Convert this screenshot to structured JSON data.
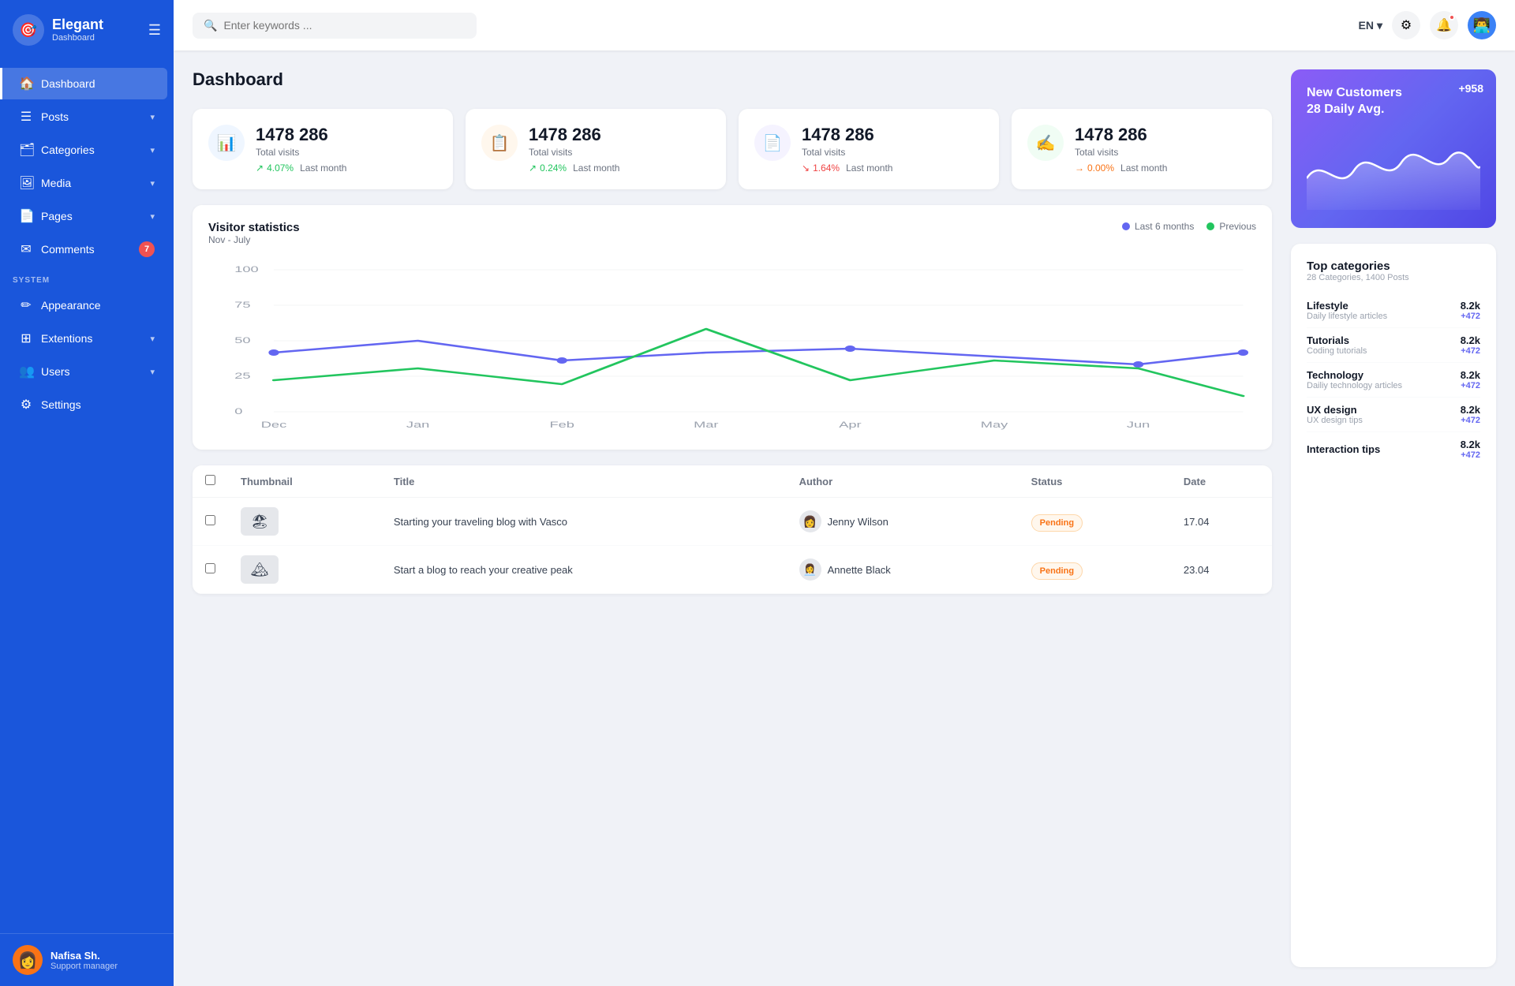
{
  "app": {
    "title": "Elegant",
    "subtitle": "Dashboard"
  },
  "header": {
    "search_placeholder": "Enter keywords ...",
    "language": "EN",
    "page_title": "Dashboard"
  },
  "sidebar": {
    "nav_items": [
      {
        "id": "dashboard",
        "label": "Dashboard",
        "icon": "🏠",
        "active": true,
        "badge": null,
        "has_chevron": false
      },
      {
        "id": "posts",
        "label": "Posts",
        "icon": "☰",
        "active": false,
        "badge": null,
        "has_chevron": true
      },
      {
        "id": "categories",
        "label": "Categories",
        "icon": "🗂",
        "active": false,
        "badge": null,
        "has_chevron": true
      },
      {
        "id": "media",
        "label": "Media",
        "icon": "🖼",
        "active": false,
        "badge": null,
        "has_chevron": true
      },
      {
        "id": "pages",
        "label": "Pages",
        "icon": "📄",
        "active": false,
        "badge": null,
        "has_chevron": true
      },
      {
        "id": "comments",
        "label": "Comments",
        "icon": "✉",
        "active": false,
        "badge": "7",
        "has_chevron": false
      }
    ],
    "system_section": "SYSTEM",
    "system_items": [
      {
        "id": "appearance",
        "label": "Appearance",
        "icon": "✏",
        "has_chevron": false
      },
      {
        "id": "extensions",
        "label": "Extentions",
        "icon": "⊞",
        "has_chevron": true
      },
      {
        "id": "users",
        "label": "Users",
        "icon": "👥",
        "has_chevron": true
      },
      {
        "id": "settings",
        "label": "Settings",
        "icon": "⚙",
        "has_chevron": false
      }
    ],
    "user": {
      "name": "Nafisa Sh.",
      "role": "Support manager"
    }
  },
  "stat_cards": [
    {
      "number": "1478 286",
      "label": "Total visits",
      "change": "4.07%",
      "direction": "up",
      "last_month": "Last month",
      "icon": "📊",
      "color": "blue"
    },
    {
      "number": "1478 286",
      "label": "Total visits",
      "change": "0.24%",
      "direction": "up",
      "last_month": "Last month",
      "icon": "📋",
      "color": "orange"
    },
    {
      "number": "1478 286",
      "label": "Total visits",
      "change": "1.64%",
      "direction": "down",
      "last_month": "Last month",
      "icon": "📄",
      "color": "purple"
    },
    {
      "number": "1478 286",
      "label": "Total visits",
      "change": "0.00%",
      "direction": "neutral",
      "last_month": "Last month",
      "icon": "✍",
      "color": "green"
    }
  ],
  "chart": {
    "title": "Visitor statistics",
    "subtitle": "Nov - July",
    "legend": [
      {
        "label": "Last 6 months",
        "color": "purple"
      },
      {
        "label": "Previous",
        "color": "green"
      }
    ],
    "y_labels": [
      "100",
      "75",
      "50",
      "25",
      "0"
    ],
    "x_labels": [
      "Dec",
      "Jan",
      "Feb",
      "Mar",
      "Apr",
      "May",
      "Jun"
    ]
  },
  "table": {
    "columns": [
      "",
      "Thumbnail",
      "Title",
      "Author",
      "Status",
      "Date"
    ],
    "rows": [
      {
        "thumbnail": "🏖",
        "title": "Starting your traveling blog with Vasco",
        "author": "Jenny Wilson",
        "status": "Pending",
        "date": "17.04"
      },
      {
        "thumbnail": "🏔",
        "title": "Start a blog to reach your creative peak",
        "author": "Annette Black",
        "status": "Pending",
        "date": "23.04"
      }
    ]
  },
  "new_customers": {
    "title": "New Customers",
    "daily_avg": "28 Daily Avg.",
    "badge": "+958"
  },
  "top_categories": {
    "title": "Top categories",
    "subtitle": "28 Categories, 1400 Posts",
    "items": [
      {
        "name": "Lifestyle",
        "desc": "Daily lifestyle articles",
        "count": "8.2k",
        "change": "+472"
      },
      {
        "name": "Tutorials",
        "desc": "Coding tutorials",
        "count": "8.2k",
        "change": "+472"
      },
      {
        "name": "Technology",
        "desc": "Dailiy technology articles",
        "count": "8.2k",
        "change": "+472"
      },
      {
        "name": "UX design",
        "desc": "UX design tips",
        "count": "8.2k",
        "change": "+472"
      },
      {
        "name": "Interaction tips",
        "desc": "",
        "count": "8.2k",
        "change": "+472"
      }
    ]
  }
}
